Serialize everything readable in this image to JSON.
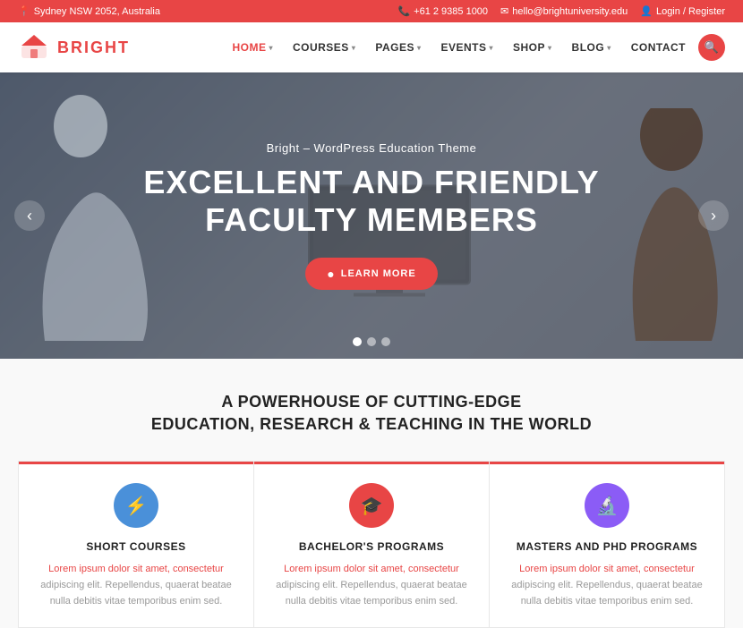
{
  "topbar": {
    "location": "Sydney NSW 2052, Australia",
    "phone": "+61 2 9385 1000",
    "email": "hello@brightuniversity.edu",
    "login": "Login / Register",
    "location_icon": "📍",
    "phone_icon": "📞",
    "email_icon": "✉"
  },
  "navbar": {
    "logo_text": "BRIGHT",
    "nav_items": [
      {
        "label": "HOME",
        "has_arrow": true,
        "active": true
      },
      {
        "label": "COURSES",
        "has_arrow": true,
        "active": false
      },
      {
        "label": "PAGES",
        "has_arrow": true,
        "active": false
      },
      {
        "label": "EVENTS",
        "has_arrow": true,
        "active": false
      },
      {
        "label": "SHOP",
        "has_arrow": true,
        "active": false
      },
      {
        "label": "BLOG",
        "has_arrow": true,
        "active": false
      },
      {
        "label": "CONTACT",
        "has_arrow": false,
        "active": false
      }
    ],
    "search_icon": "🔍"
  },
  "hero": {
    "subtitle": "Bright – WordPress Education Theme",
    "title_line1": "EXCELLENT AND FRIENDLY",
    "title_line2": "FACULTY MEMBERS",
    "btn_label": "LEARN MORE",
    "dots": [
      1,
      2,
      3
    ],
    "active_dot": 1
  },
  "features": {
    "heading_line1": "A POWERHOUSE OF CUTTING-EDGE",
    "heading_line2": "EDUCATION, RESEARCH & TEACHING IN THE WORLD",
    "cards": [
      {
        "icon": "⚡",
        "icon_class": "icon-blue",
        "title": "SHORT COURSES",
        "text_red": "Lorem ipsum dolor sit amet, consectetur",
        "text_gray": "adipiscing elit. Repellendus, quaerat beatae nulla debitis vitae temporibus enim sed."
      },
      {
        "icon": "🎓",
        "icon_class": "icon-red",
        "title": "BACHELOR'S PROGRAMS",
        "text_red": "Lorem ipsum dolor sit amet, consectetur",
        "text_gray": "adipiscing elit. Repellendus, quaerat beatae nulla debitis vitae temporibus enim sed."
      },
      {
        "icon": "🔬",
        "icon_class": "icon-purple",
        "title": "MASTERS AND PHD PROGRAMS",
        "text_red": "Lorem ipsum dolor sit amet, consectetur",
        "text_gray": "adipiscing elit. Repellendus, quaerat beatae nulla debitis vitae temporibus enim sed."
      }
    ]
  }
}
